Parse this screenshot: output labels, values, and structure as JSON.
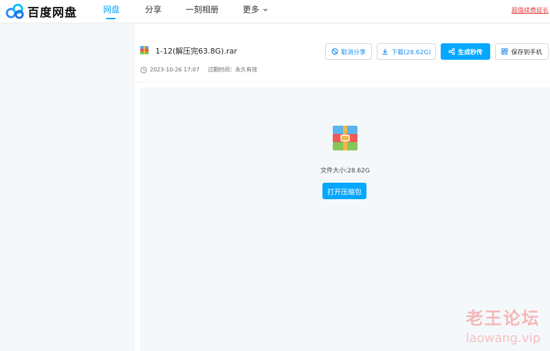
{
  "header": {
    "logo_text": "百度网盘",
    "nav": [
      {
        "label": "网盘",
        "active": true
      },
      {
        "label": "分享",
        "active": false
      },
      {
        "label": "一刻相册",
        "active": false
      },
      {
        "label": "更多",
        "active": false
      }
    ],
    "top_link": "超值续费延长"
  },
  "file": {
    "name": "1-12(解压完63.8G).rar",
    "date": "2023-10-26 17:07",
    "expire": "过期时间：永久有效"
  },
  "actions": {
    "cancel_share": "取消分享",
    "download": "下载(28.62G)",
    "generate": "生成秒传",
    "save_to_phone": "保存到手机"
  },
  "preview": {
    "size_text": "文件大小:28.62G",
    "open_button": "打开压缩包"
  },
  "watermark": {
    "cn": "老王论坛",
    "en": "laowang.vip"
  },
  "colors": {
    "accent": "#06a7ff",
    "link_red": "#e53e3e"
  }
}
